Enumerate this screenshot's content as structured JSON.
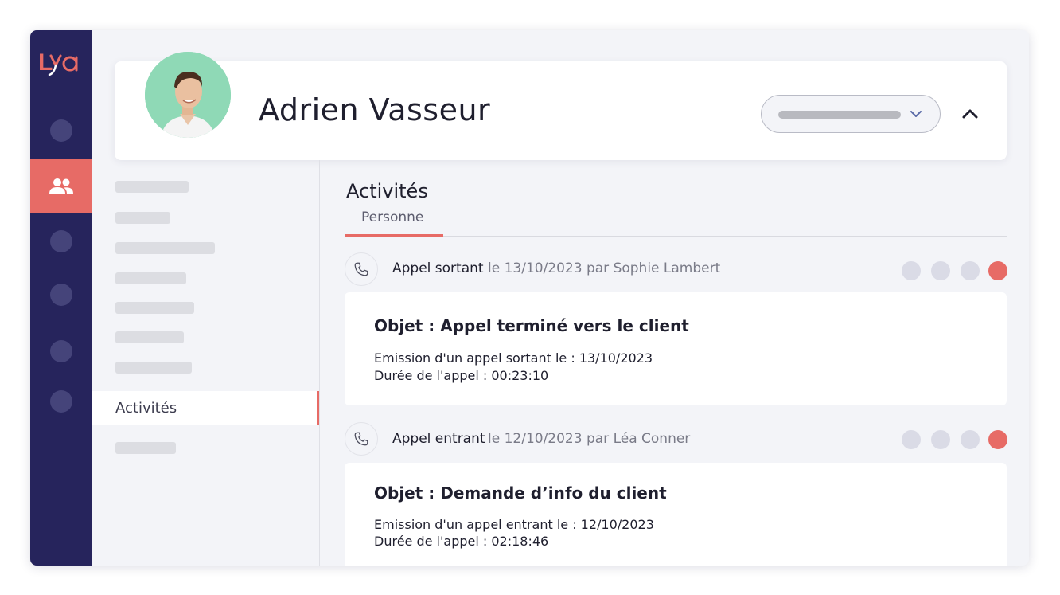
{
  "app": {
    "logo_text": "Lya",
    "brand_color": "#e76b66",
    "sidebar_color": "#26245c"
  },
  "sidebar": {
    "items": [
      {
        "icon": "circle-placeholder"
      },
      {
        "icon": "users-icon",
        "active": true
      },
      {
        "icon": "circle-placeholder"
      },
      {
        "icon": "circle-placeholder"
      },
      {
        "icon": "circle-placeholder"
      },
      {
        "icon": "circle-placeholder"
      }
    ]
  },
  "header": {
    "name": "Adrien Vasseur",
    "avatar_icon": "user-photo",
    "select_value": "",
    "collapse_icon": "chevron-up-icon"
  },
  "side_menu": {
    "active_label": "Activités"
  },
  "main": {
    "title": "Activités",
    "tabs": [
      {
        "label": "Personne",
        "active": true
      }
    ]
  },
  "activities": [
    {
      "type": "Appel sortant",
      "meta": "le 13/10/2023 par Sophie Lambert",
      "icon": "phone-icon",
      "subject": "Objet : Appel terminé vers le client",
      "line1": "Emission d'un appel sortant le : 13/10/2023",
      "line2": "Durée de l'appel : 00:23:10",
      "status_dots": [
        "grey",
        "grey",
        "grey",
        "red"
      ]
    },
    {
      "type": "Appel entrant",
      "meta": "le 12/10/2023 par Léa Conner",
      "icon": "phone-icon",
      "subject": "Objet : Demande d’info du client",
      "line1": "Emission d'un appel entrant le : 12/10/2023",
      "line2": "Durée de l'appel : 02:18:46",
      "status_dots": [
        "grey",
        "grey",
        "grey",
        "red"
      ]
    }
  ]
}
